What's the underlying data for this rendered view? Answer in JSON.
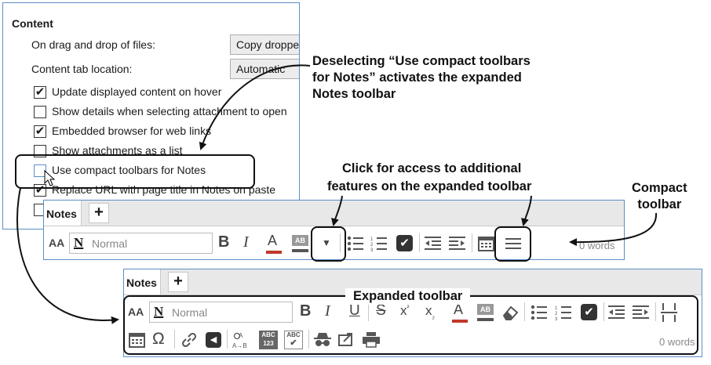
{
  "settings": {
    "heading": "Content",
    "drag_drop_label": "On drag and drop of files:",
    "drag_drop_value": "Copy dropped",
    "tab_location_label": "Content tab location:",
    "tab_location_value": "Automatic",
    "checkboxes": [
      {
        "label": "Update displayed content on hover",
        "checked": true
      },
      {
        "label": "Show details when selecting attachment to open",
        "checked": true
      },
      {
        "label": "Embedded browser for web links",
        "checked": true
      },
      {
        "label": "Show attachments as a list",
        "checked": false
      },
      {
        "label": "Use compact toolbars for Notes",
        "checked": false
      },
      {
        "label": "Replace URL with page title in Notes on paste",
        "checked": true
      }
    ]
  },
  "compact": {
    "tab_label": "Notes",
    "plus": "+",
    "style_icon": "N",
    "style_name": "Normal",
    "font_size_icon": "AA",
    "words": "0 words"
  },
  "expanded": {
    "tab_label": "Notes",
    "plus": "+",
    "style_icon": "N",
    "style_name": "Normal",
    "font_size_icon": "AA",
    "words": "0 words"
  },
  "annotations": {
    "deselect_line1": "Deselecting “Use compact toolbars",
    "deselect_line2": "for Notes” activates the expanded",
    "deselect_line3": "Notes toolbar",
    "click_line1": "Click for access to additional",
    "click_line2": "features on the expanded toolbar",
    "compact_line1": "Compact",
    "compact_line2": "toolbar",
    "expanded_label": "Expanded toolbar"
  },
  "icons": [
    "check-icon",
    "font-size-icon",
    "style-icon",
    "bold-icon",
    "italic-icon",
    "font-color-icon",
    "highlight-icon",
    "dropdown-icon",
    "bullet-list-icon",
    "numbered-list-icon",
    "checkbox-icon",
    "outdent-icon",
    "indent-icon",
    "calendar-icon",
    "more-icon",
    "underline-icon",
    "strikethrough-icon",
    "superscript-icon",
    "subscript-icon",
    "eraser-icon",
    "horizontal-rule-icon",
    "omega-icon",
    "link-icon",
    "back-icon",
    "replace-icon",
    "spellcheck-icon",
    "spellcheck-check-icon",
    "spy-icon",
    "export-icon",
    "print-icon"
  ],
  "colors": {
    "panel_border": "#5b8fc7",
    "font_color_bar": "#c0392b",
    "highlight_bar": "#555555"
  }
}
